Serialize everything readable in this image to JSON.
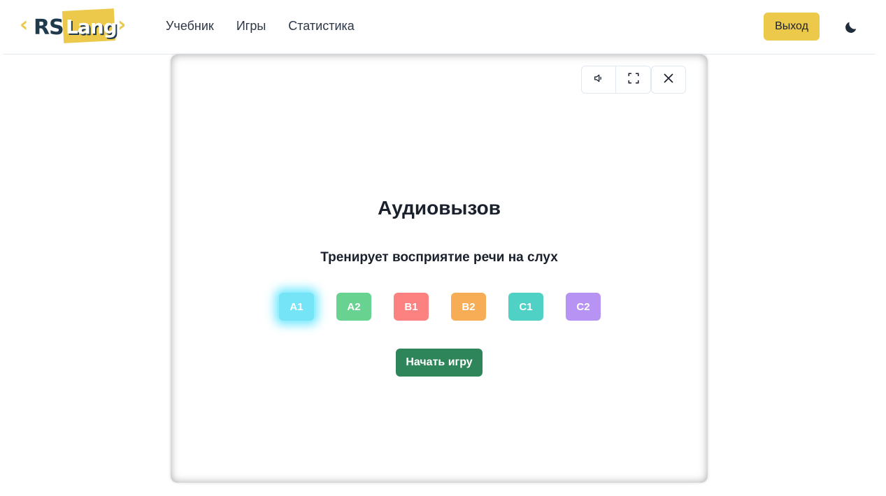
{
  "header": {
    "logo": {
      "left_text": "RS",
      "right_text": "Lang"
    },
    "nav": [
      {
        "label": "Учебник"
      },
      {
        "label": "Игры"
      },
      {
        "label": "Статистика"
      }
    ],
    "logout_label": "Выход",
    "theme_icon": "moon-icon"
  },
  "game": {
    "controls": [
      {
        "icon": "speaker-icon"
      },
      {
        "icon": "fullscreen-icon"
      },
      {
        "icon": "close-icon"
      }
    ],
    "title": "Аудиовызов",
    "subtitle": "Тренирует восприятие речи на слух",
    "levels": [
      {
        "label": "A1",
        "color": "#76e4f7",
        "selected": true
      },
      {
        "label": "A2",
        "color": "#68d391",
        "selected": false
      },
      {
        "label": "B1",
        "color": "#fc8181",
        "selected": false
      },
      {
        "label": "B2",
        "color": "#f6ad55",
        "selected": false
      },
      {
        "label": "C1",
        "color": "#4fd1c5",
        "selected": false
      },
      {
        "label": "C2",
        "color": "#b794f4",
        "selected": false
      }
    ],
    "start_label": "Начать игру"
  },
  "colors": {
    "accent": "#ecc94b",
    "start": "#2f855a",
    "text": "#1a202c"
  }
}
